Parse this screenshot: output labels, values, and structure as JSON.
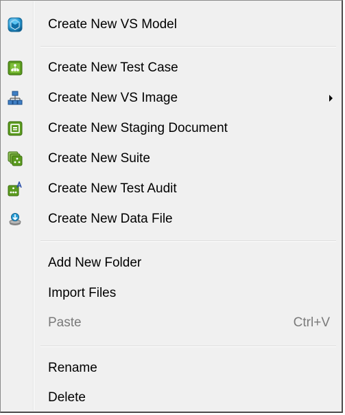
{
  "menu": {
    "items": [
      {
        "label": "Create New VS Model",
        "icon": "vs-model-cube-icon"
      },
      {
        "label": "Create New Test Case",
        "icon": "test-case-icon"
      },
      {
        "label": "Create New VS Image",
        "icon": "vs-image-network-icon",
        "submenu": true
      },
      {
        "label": "Create New Staging Document",
        "icon": "staging-document-icon"
      },
      {
        "label": "Create New Suite",
        "icon": "suite-icon"
      },
      {
        "label": "Create New Test Audit",
        "icon": "test-audit-icon"
      },
      {
        "label": "Create New Data File",
        "icon": "data-file-icon"
      },
      {
        "label": "Add New Folder"
      },
      {
        "label": "Import Files"
      },
      {
        "label": "Paste",
        "shortcut": "Ctrl+V",
        "disabled": true
      },
      {
        "label": "Rename"
      },
      {
        "label": "Delete"
      }
    ]
  },
  "colors": {
    "menu_bg": "#f0f0f0",
    "icon_green": "#5a9a1e",
    "icon_teal": "#2a9fd8",
    "disabled_text": "#7a7a7a"
  }
}
